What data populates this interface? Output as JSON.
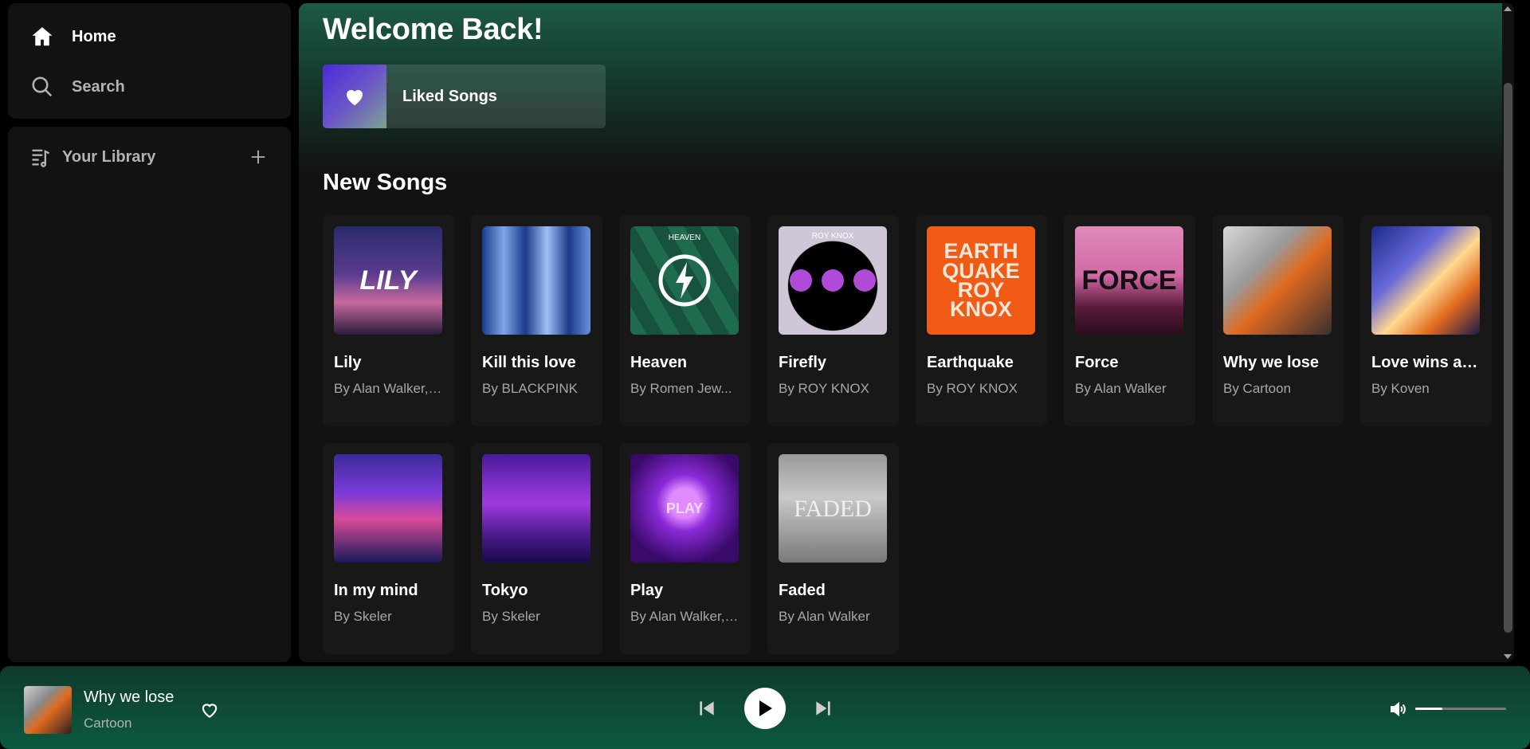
{
  "nav": {
    "home_label": "Home",
    "search_label": "Search"
  },
  "library": {
    "label": "Your Library"
  },
  "main": {
    "welcome": "Welcome Back!",
    "liked_songs_label": "Liked Songs",
    "section_title": "New Songs",
    "songs": [
      {
        "title": "Lily",
        "artist": "By Alan Walker, ...",
        "cover_text": "LILY"
      },
      {
        "title": "Kill this love",
        "artist": "By BLACKPINK",
        "cover_text": ""
      },
      {
        "title": "Heaven",
        "artist": "By Romen Jew...",
        "cover_text": "HEAVEN"
      },
      {
        "title": "Firefly",
        "artist": "By ROY KNOX",
        "cover_text": "ROY KNOX"
      },
      {
        "title": "Earthquake",
        "artist": "By ROY KNOX",
        "cover_text": "EARTH QUAKE ROY KNOX"
      },
      {
        "title": "Force",
        "artist": "By Alan Walker",
        "cover_text": "FORCE"
      },
      {
        "title": "Why we lose",
        "artist": "By Cartoon",
        "cover_text": ""
      },
      {
        "title": "Love wins ag...",
        "artist": "By Koven",
        "cover_text": ""
      },
      {
        "title": "In my mind",
        "artist": "By Skeler",
        "cover_text": ""
      },
      {
        "title": "Tokyo",
        "artist": "By Skeler",
        "cover_text": ""
      },
      {
        "title": "Play",
        "artist": "By Alan Walker, ...",
        "cover_text": "PLAY"
      },
      {
        "title": "Faded",
        "artist": "By Alan Walker",
        "cover_text": "FADED"
      }
    ]
  },
  "player": {
    "title": "Why we lose",
    "artist": "Cartoon",
    "volume_fraction": 0.3
  },
  "colors": {
    "accent_green": "#0c5a40",
    "panel_bg": "#121212",
    "card_bg": "#181818"
  },
  "icons": {
    "home": "home-icon",
    "search": "search-icon",
    "library": "library-icon",
    "plus": "plus-icon",
    "heart": "heart-icon",
    "prev": "skip-back-icon",
    "play": "play-icon",
    "next": "skip-forward-icon",
    "volume": "volume-icon"
  }
}
